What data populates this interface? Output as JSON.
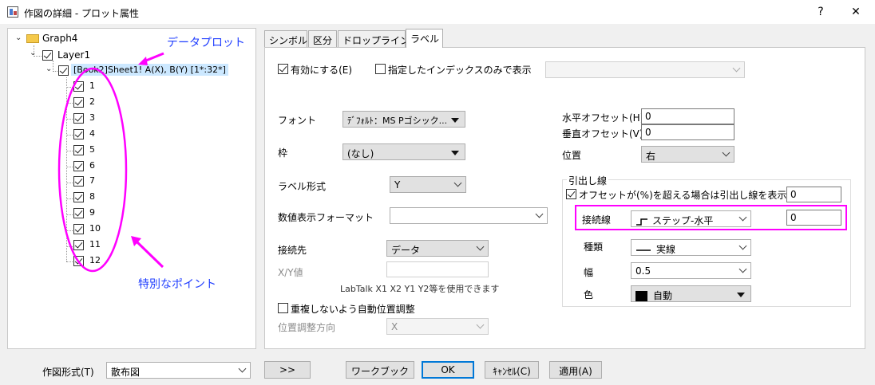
{
  "window": {
    "title": "作図の詳細 - プロット属性",
    "help": "?",
    "close": "✕"
  },
  "tree": {
    "root": "Graph4",
    "layer": "Layer1",
    "plot": "[Book2]Sheet1! A(X), B(Y) [1*:32*]",
    "points": [
      "1",
      "2",
      "3",
      "4",
      "5",
      "6",
      "7",
      "8",
      "9",
      "10",
      "11",
      "12"
    ]
  },
  "annotations": {
    "data_plot": "データプロット",
    "special_points": "特別なポイント"
  },
  "tabs": [
    "シンボル",
    "区分",
    "ドロップライン",
    "ラベル"
  ],
  "label_tab": {
    "enable": "有効にする(E)",
    "show_only_index": "指定したインデックスのみで表示",
    "index_combo": "",
    "font_label": "フォント",
    "font_value": "ﾃﾞﾌｫﾙﾄ：MS Pゴシック...",
    "frame_label": "枠",
    "frame_value": "(なし)",
    "format_label": "ラベル形式",
    "format_value": "Y",
    "numfmt_label": "数値表示フォーマット",
    "numfmt_value": "",
    "connect_label": "接続先",
    "connect_value": "データ",
    "xy_label": "X/Y値",
    "xy_value": "",
    "labtalk_hint": "LabTalk X1 X2 Y1 Y2等を使用できます",
    "no_overlap": "重複しないよう自動位置調整",
    "adjust_dir_label": "位置調整方向",
    "adjust_dir_value": "X",
    "h_offset_label": "水平オフセット(H)",
    "h_offset_value": "0",
    "v_offset_label": "垂直オフセット(V)",
    "v_offset_value": "0",
    "position_label": "位置",
    "position_value": "右",
    "leader": {
      "group_title": "引出し線",
      "show_if": "オフセットが(%)を超える場合は引出し線を表示",
      "show_if_value": "0",
      "connector_label": "接続線",
      "connector_value": "ステップ-水平",
      "connector_num": "0",
      "type_label": "種類",
      "type_value": "実線",
      "width_label": "幅",
      "width_value": "0.5",
      "color_label": "色",
      "color_value": "自動",
      "color_swatch": "#000000"
    }
  },
  "bottom": {
    "plot_type_label": "作図形式(T)",
    "plot_type_value": "散布図",
    "expand": ">>",
    "workbook": "ワークブック",
    "ok": "OK",
    "cancel": "ｷｬﾝｾﾙ(C)",
    "apply": "適用(A)"
  },
  "colors": {
    "annotation_magenta": "#ff00ff",
    "annotation_text": "#1e3cff",
    "selection": "#cce8ff",
    "default_button_border": "#0078d7"
  }
}
